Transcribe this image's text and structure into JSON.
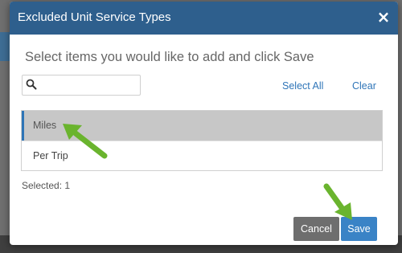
{
  "modal": {
    "title": "Excluded Unit Service Types",
    "close_label": "×",
    "instructions": "Select items you would like to add and click Save"
  },
  "search": {
    "value": "",
    "placeholder": ""
  },
  "actions": {
    "select_all": "Select All",
    "clear": "Clear"
  },
  "list": {
    "items": [
      {
        "label": "Miles",
        "selected": true
      },
      {
        "label": "Per Trip",
        "selected": false
      }
    ]
  },
  "selection": {
    "summary": "Selected: 1"
  },
  "footer": {
    "cancel_label": "Cancel",
    "save_label": "Save"
  },
  "colors": {
    "header": "#2e5f8d",
    "link": "#2f75b8",
    "save": "#3a83c6",
    "cancel": "#6e6e6e",
    "selected_row": "#c7c7c7",
    "annotation_arrow": "#6ab42e"
  },
  "annotations": {
    "arrow_icon": "green-pointer-arrow"
  }
}
